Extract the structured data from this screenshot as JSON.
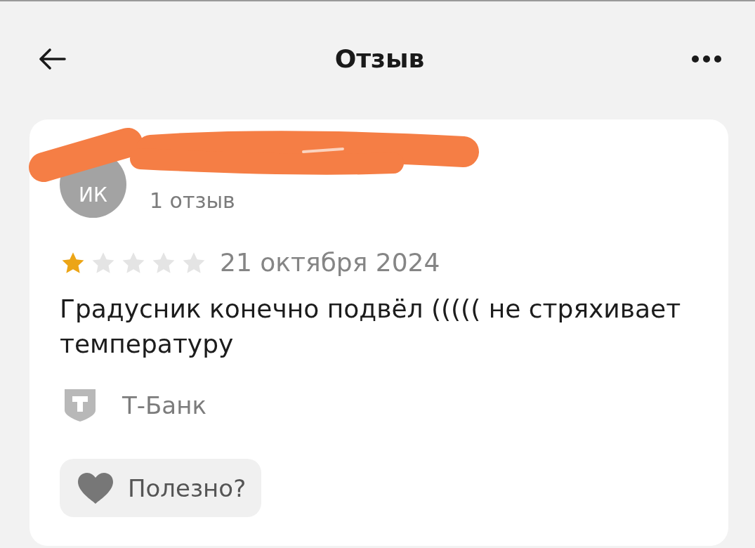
{
  "header": {
    "title": "Отзыв"
  },
  "review": {
    "author": {
      "initials": "ИК",
      "reviews_count": "1 отзыв"
    },
    "stars": 1,
    "date": "21 октября 2024",
    "text": "Градусник конечно подвёл ((((( не стряхивает температуру",
    "source": "Т-Банк",
    "helpful_button": {
      "label": "Полезно?"
    }
  }
}
